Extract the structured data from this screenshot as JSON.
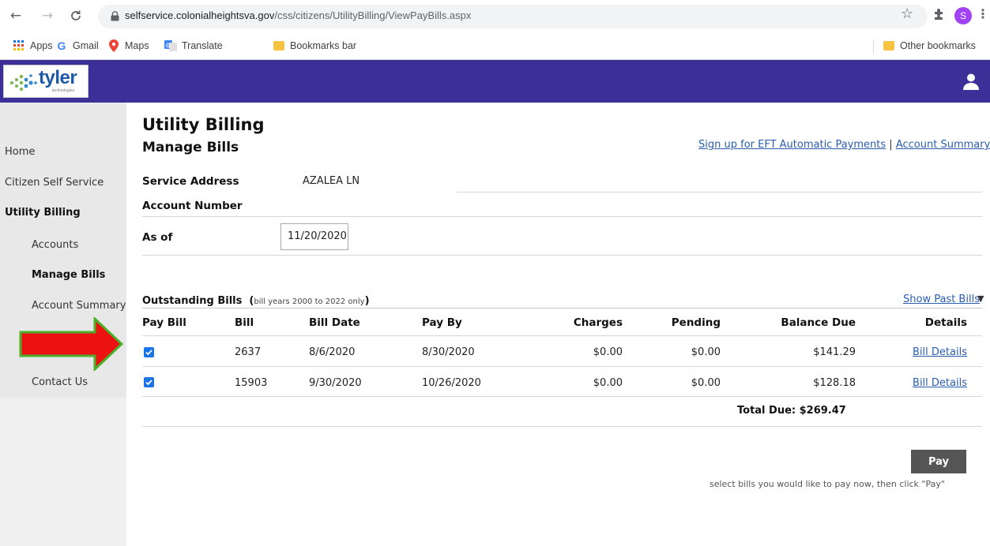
{
  "browser": {
    "url_host": "selfservice.colonialheightsva.gov",
    "url_path": "/css/citizens/UtilityBilling/ViewPayBills.aspx",
    "profile_initial": "S",
    "bookmarks": [
      "Apps",
      "Gmail",
      "Maps",
      "Translate",
      "Bookmarks bar"
    ],
    "other_bookmarks": "Other bookmarks"
  },
  "header": {
    "logo_text": "tyler",
    "logo_sub": "technologies",
    "brand_color": "#3c2f97"
  },
  "sidebar": {
    "items": [
      {
        "label": "Home"
      },
      {
        "label": "Citizen Self Service"
      },
      {
        "label": "Utility Billing"
      }
    ],
    "sub_items": [
      {
        "label": "Accounts"
      },
      {
        "label": "Manage Bills"
      },
      {
        "label": "Account Summary"
      }
    ],
    "contact": "Contact Us"
  },
  "main": {
    "title": "Utility Billing",
    "subtitle": "Manage Bills",
    "links": {
      "eft": "Sign up for EFT Automatic Payments",
      "separator": "|",
      "summary": "Account Summary"
    },
    "fields": {
      "service_address_label": "Service Address",
      "service_address_value": "AZALEA LN",
      "account_number_label": "Account Number",
      "as_of_label": "As of",
      "as_of_value": "11/20/2020"
    },
    "outstanding": {
      "title": "Outstanding Bills",
      "note": "bill years 2000 to 2022 only",
      "show_past": "Show Past Bills"
    },
    "table": {
      "headers": {
        "pay_bill": "Pay Bill",
        "bill": "Bill",
        "bill_date": "Bill Date",
        "pay_by": "Pay By",
        "charges": "Charges",
        "pending": "Pending",
        "balance_due": "Balance Due",
        "details": "Details"
      },
      "rows": [
        {
          "checked": true,
          "bill": "2637",
          "bill_date": "8/6/2020",
          "pay_by": "8/30/2020",
          "charges": "$0.00",
          "pending": "$0.00",
          "balance_due": "$141.29",
          "details": "Bill Details"
        },
        {
          "checked": true,
          "bill": "15903",
          "bill_date": "9/30/2020",
          "pay_by": "10/26/2020",
          "charges": "$0.00",
          "pending": "$0.00",
          "balance_due": "$128.18",
          "details": "Bill Details"
        }
      ],
      "total": "Total Due: $269.47"
    },
    "pay_button": "Pay",
    "pay_hint": "select bills you would like to pay now, then click \"Pay\""
  },
  "icons": {
    "back": "arrow-left-icon",
    "forward": "arrow-right-icon",
    "reload": "reload-icon",
    "user": "user-icon",
    "annotation": "red-arrow-icon"
  }
}
